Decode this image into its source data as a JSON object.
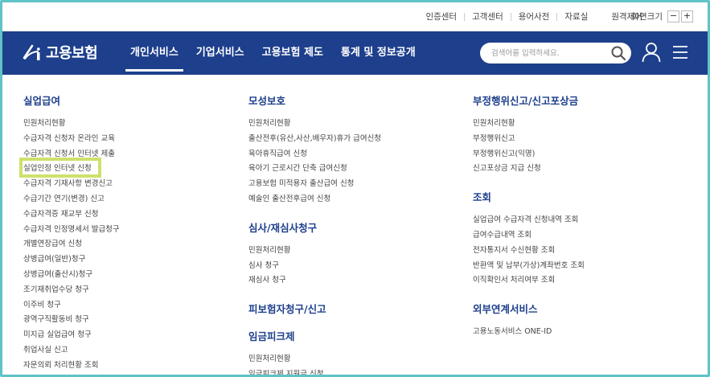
{
  "util": {
    "links": [
      "인증센터",
      "고객센터",
      "용어사전",
      "자료실"
    ],
    "remote": "원격제어",
    "zoom_label": "화면크기",
    "zoom_minus": "−",
    "zoom_plus": "+"
  },
  "header": {
    "logo_text": "고용보험",
    "nav": [
      "개인서비스",
      "기업서비스",
      "고용보험 제도",
      "통계 및 정보공개"
    ],
    "search_placeholder": "검색어를 입력하세요."
  },
  "col1": {
    "sections": [
      {
        "title": "실업급여",
        "items": [
          "민원처리현황",
          "수급자격 신청자 온라인 교육",
          "수급자격 신청서 인터넷 제출",
          "실업인정 인터넷 신청",
          "수급자격 기재사항 변경신고",
          "수급기간 연기(변경) 신고",
          "수급자격증 재교부 신청",
          "수급자격 인정명세서 발급청구",
          "개별연장급여 신청",
          "상병급여(일반)청구",
          "상병급여(출산시)청구",
          "조기재취업수당 청구",
          "이주비 청구",
          "광역구직활동비 청구",
          "미지급 실업급여 청구",
          "취업사실 신고",
          "자문의뢰 처리현황 조회"
        ]
      }
    ]
  },
  "col2": {
    "sections": [
      {
        "title": "모성보호",
        "items": [
          "민원처리현황",
          "출산전후(유산,사산,배우자)휴가 급여신청",
          "육아휴직급여 신청",
          "육아기 근로시간 단축 급여신청",
          "고용보험 미적용자 출산급여 신청",
          "예술인 출산전후급여 신청"
        ]
      },
      {
        "title": "심사/재심사청구",
        "items": [
          "민원처리현황",
          "심사 청구",
          "재심사 청구"
        ]
      },
      {
        "title": "피보험자청구/신고",
        "items": []
      },
      {
        "title": "임금피크제",
        "items": [
          "민원처리현황",
          "임금피크제 지원금 신청"
        ]
      }
    ]
  },
  "col3": {
    "sections": [
      {
        "title": "부정행위신고/신고포상금",
        "items": [
          "민원처리현황",
          "부정행위신고",
          "부정행위신고(익명)",
          "신고포상금 지급 신청"
        ]
      },
      {
        "title": "조회",
        "items": [
          "실업급여 수급자격 신청내역 조회",
          "급여수급내역 조회",
          "전자통지서 수신현황 조회",
          "반환액 및 납부(가상)계좌번호 조회",
          "이직확인서 처리여부 조회"
        ]
      },
      {
        "title": "외부연계서비스",
        "items": [
          "고용노동서비스 ONE-ID"
        ]
      }
    ]
  },
  "colors": {
    "brand": "#1d3f8c",
    "highlight": "#cfe06c",
    "frame": "#5fc3c7"
  }
}
